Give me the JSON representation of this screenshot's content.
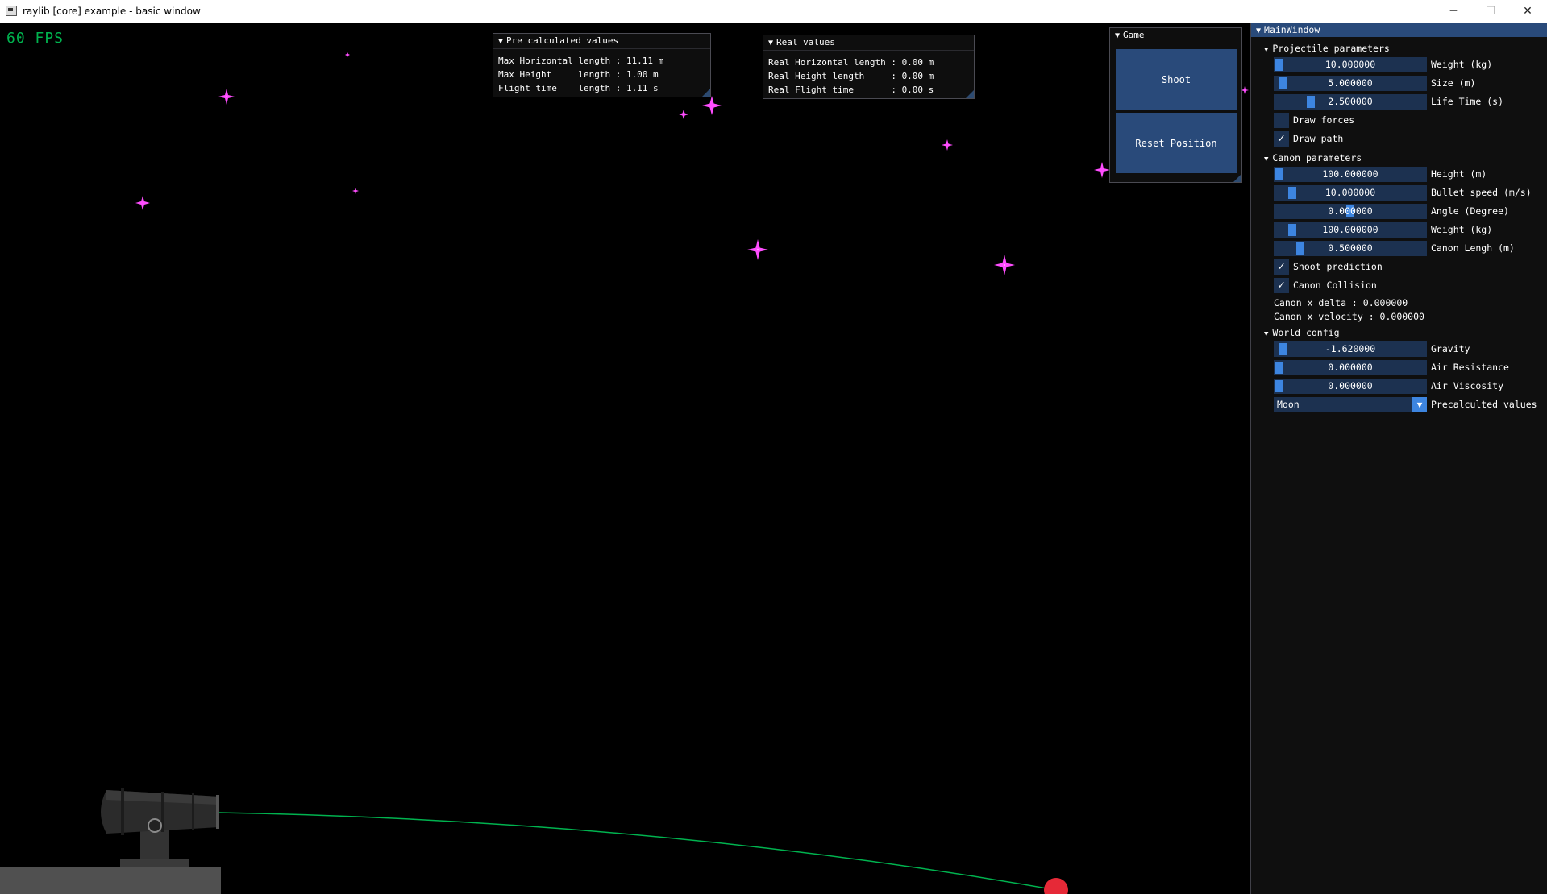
{
  "window": {
    "title": "raylib [core] example - basic window",
    "minimize": "─",
    "maximize": "☐",
    "close": "✕"
  },
  "viewport": {
    "fps": "60 FPS"
  },
  "precalc": {
    "title": "Pre calculated values",
    "rows": [
      "Max Horizontal length : 11.11 m",
      "Max Height     length : 1.00 m",
      "Flight time    length : 1.11 s"
    ]
  },
  "real": {
    "title": "Real values",
    "rows": [
      "Real Horizontal length : 0.00 m",
      "Real Height length     : 0.00 m",
      "Real Flight time       : 0.00 s"
    ]
  },
  "game": {
    "title": "Game",
    "shoot": "Shoot",
    "reset": "Reset Position"
  },
  "main": {
    "title": "MainWindow",
    "projectile": {
      "header": "Projectile parameters",
      "weight": {
        "value": "10.000000",
        "label": "Weight (kg)",
        "fraction": 0.0
      },
      "size": {
        "value": "5.000000",
        "label": "Size (m)",
        "fraction": 0.02
      },
      "lifetime": {
        "value": "2.500000",
        "label": "Life Time (s)",
        "fraction": 0.22
      },
      "draw_forces": {
        "label": "Draw forces",
        "checked": false
      },
      "draw_path": {
        "label": "Draw path",
        "checked": true
      }
    },
    "canon": {
      "header": "Canon parameters",
      "height": {
        "value": "100.000000",
        "label": "Height (m)",
        "fraction": 0.0
      },
      "bullet_speed": {
        "value": "10.000000",
        "label": "Bullet speed (m/s)",
        "fraction": 0.09
      },
      "angle": {
        "value": "0.000000",
        "label": "Angle (Degree)",
        "fraction": 0.5
      },
      "weight": {
        "value": "100.000000",
        "label": "Weight (kg)",
        "fraction": 0.09
      },
      "length": {
        "value": "0.500000",
        "label": "Canon Lengh (m)",
        "fraction": 0.15
      },
      "shoot_prediction": {
        "label": "Shoot prediction",
        "checked": true
      },
      "canon_collision": {
        "label": "Canon Collision",
        "checked": true
      },
      "x_delta": "Canon x delta : 0.000000",
      "x_velocity": "Canon x velocity : 0.000000"
    },
    "world": {
      "header": "World config",
      "gravity": {
        "value": "-1.620000",
        "label": "Gravity",
        "fraction": 0.03
      },
      "air_resistance": {
        "value": "0.000000",
        "label": "Air Resistance",
        "fraction": 0.0
      },
      "air_viscosity": {
        "value": "0.000000",
        "label": "Air Viscosity",
        "fraction": 0.0
      },
      "precalc": {
        "value": "Moon",
        "label": "Precalculted values"
      }
    }
  },
  "colors": {
    "accent": "#294a7a",
    "slider_grab": "#3d85e0",
    "frame_bg": "#1c3150",
    "star": "#ff4dff",
    "path": "#00b34f",
    "ball": "#e62937"
  }
}
